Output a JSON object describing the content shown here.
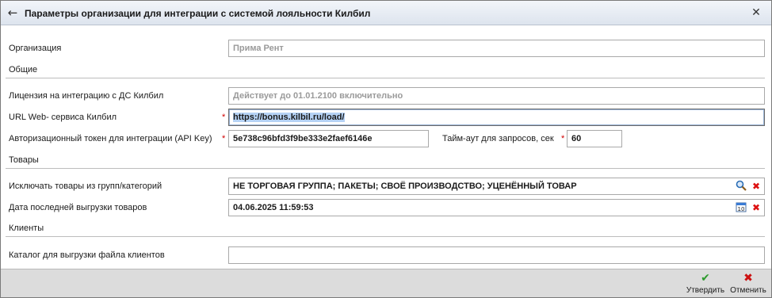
{
  "window": {
    "title": "Параметры организации для интеграции с системой лояльности Килбил",
    "back_icon": "arrow-left-icon",
    "close_icon": "close-icon"
  },
  "organization": {
    "label": "Организация",
    "value": "Прима Рент"
  },
  "general": {
    "section_title": "Общие",
    "license_label": "Лицензия на интеграцию с ДС Килбил",
    "license_value": "Действует до 01.01.2100 включительно",
    "url_label": "URL Web- сервиса Килбил",
    "url_value": "https://bonus.kilbil.ru/load/",
    "token_label": "Авторизационный токен для интеграции  (API Key)",
    "token_value": "5e738c96bfd3f9be333e2faef6146e",
    "timeout_label": "Тайм-аут для запросов, сек",
    "timeout_value": "60",
    "required_mark": "*"
  },
  "goods": {
    "section_title": "Товары",
    "exclude_label": "Исключать товары из групп/категорий",
    "exclude_value": "НЕ ТОРГОВАЯ ГРУППА; ПАКЕТЫ; СВОЁ ПРОИЗВОДСТВО; УЦЕНЁННЫЙ ТОВАР",
    "last_export_label": "Дата последней выгрузки товаров",
    "last_export_value": "04.06.2025 11:59:53",
    "calendar_day": "10"
  },
  "clients": {
    "section_title": "Клиенты",
    "catalog_label": "Каталог для выгрузки файла клиентов",
    "catalog_value": ""
  },
  "footer": {
    "approve_label": "Утвердить",
    "cancel_label": "Отменить",
    "approve_icon": "checkmark-icon",
    "cancel_icon": "cross-icon"
  },
  "colors": {
    "required": "#d00000",
    "clear_icon": "#dd1111",
    "approve": "#2e9b2e",
    "selection": "#b5d2f5"
  }
}
